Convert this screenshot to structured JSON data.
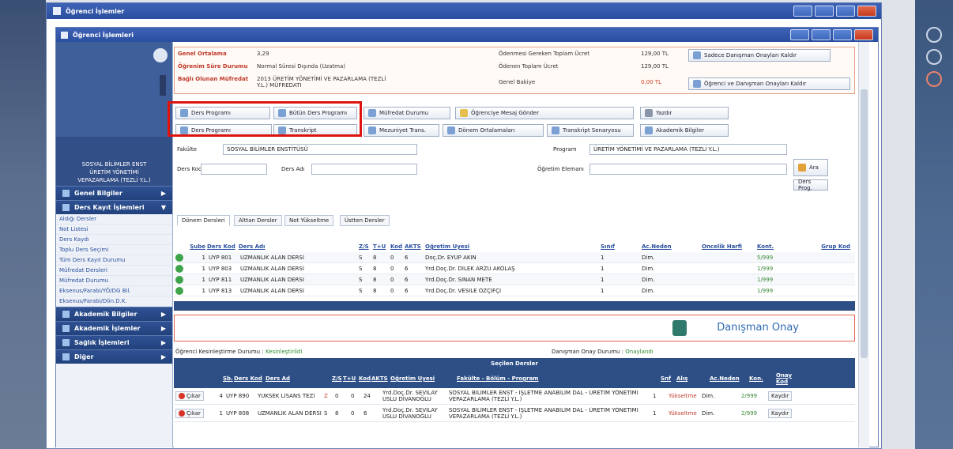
{
  "outer_window": {
    "title": "Öğrenci İşlemler"
  },
  "inner_window": {
    "title": "Öğrenci İşlemleri"
  },
  "sidebar": {
    "department": [
      "SOSYAL BİLİMLER ENST",
      "ÜRETİM YÖNETİMİ",
      "VEPAZARLAMA (TEZLİ Y.L.)"
    ],
    "sections": [
      {
        "label": "Genel Bilgiler"
      },
      {
        "label": "Ders Kayıt İşlemleri"
      }
    ],
    "links": [
      "Aldığı Dersler",
      "Not Listesi",
      "Ders Kaydı",
      "Toplu Ders Seçimi",
      "Tüm Ders Kayıt Durumu",
      "Müfredat Dersleri",
      "Müfredat Durumu",
      "Eksenus/Farabi/YÖ/DG Bil.",
      "Eksenus/Farabi/Dön.D.K."
    ],
    "bottom_sections": [
      {
        "label": "Akademik Bilgiler"
      },
      {
        "label": "Akademik İşlemler"
      },
      {
        "label": "Sağlık İşlemleri"
      },
      {
        "label": "Diğer"
      }
    ]
  },
  "info": {
    "gpa_label": "Genel Ortalama",
    "gpa_value": "3,29",
    "status_label": "Öğrenim Süre Durumu",
    "status_value": "Normal Süresi Dışında (Uzatma)",
    "curriculum_label": "Bağlı Olunan Müfredat",
    "curriculum_value": "2013 ÜRETİM YÖNETİMİ VE PAZARLAMA (TEZLİ Y.L.) MÜFREDATI",
    "fee_label": "Ödenmesi Gereken Toplam Ücret",
    "fee_value": "129,00 TL",
    "paid_label": "Ödenen Toplam Ücret",
    "paid_value": "129,00 TL",
    "balance_label": "Genel Bakiye",
    "balance_value": "0,00 TL",
    "btn_only_approved": "Sadece Danışman Onayları Kaldır",
    "btn_student_advisor": "Öğrenci ve Danışman Onayları Kaldır"
  },
  "toolbar": {
    "ders_programi": "Ders Programı",
    "butun_ders_programi": "Bütün Ders Programı",
    "mufredat_durumu": "Müfredat Durumu",
    "mesaj_gonder": "Öğrenciye Mesaj Gönder",
    "yazdir": "Yazdır",
    "ders_programi_2": "Ders Programı",
    "transkript": "Transkript",
    "mezuniyet": "Mezuniyet Trans.",
    "donem_ortalamalari": "Dönem Ortalamaları",
    "transkript_senaryosu": "Transkript Senaryosu",
    "akademik_bilgiler": "Akademik Bilgiler"
  },
  "filters": {
    "fakulte_label": "Fakülte",
    "fakulte_value": "SOSYAL BİLİMLER ENSTİTÜSÜ",
    "program_label": "Program",
    "program_value": "ÜRETİM YÖNETİMİ VE PAZARLAMA (TEZLİ Y.L.)",
    "ders_kodu_label": "Ders Kodu",
    "ders_adi_label": "Ders Adı",
    "ogretim_label": "Öğretim Elemanı",
    "ara_label": "Ara",
    "ders_prog_label": "Ders Prog."
  },
  "tabs": [
    "Dönem Dersleri",
    "Alttan Dersler",
    "Not Yükseltme",
    "Üstten Dersler"
  ],
  "course_grid": {
    "headers": [
      "Şube",
      "Ders Kod",
      "Ders Adı",
      "Z/S",
      "T+U",
      "Kod",
      "AKTS",
      "Öğretim Üyesi",
      "Sınıf",
      "Ac.Neden",
      "Öncelik Harfi",
      "Kont.",
      "Grup Kod"
    ],
    "rows": [
      [
        "1",
        "UYP 801",
        "UZMANLIK ALAN DERSİ",
        "S",
        "8",
        "0",
        "6",
        "Doç.Dr. EYÜP AKIN",
        "1",
        "Dim.",
        "",
        "5/999",
        ""
      ],
      [
        "1",
        "UYP 803",
        "UZMANLIK ALAN DERSİ",
        "S",
        "8",
        "0",
        "6",
        "Yrd.Doç.Dr. DİLEK ARZU AKOLAŞ",
        "1",
        "Dim.",
        "",
        "1/999",
        ""
      ],
      [
        "1",
        "UYP 811",
        "UZMANLIK ALAN DERSİ",
        "S",
        "8",
        "0",
        "6",
        "Yrd.Doç.Dr. SİNAN METE",
        "1",
        "Dim.",
        "",
        "1/999",
        ""
      ],
      [
        "1",
        "UYP 813",
        "UZMANLIK ALAN DERSİ",
        "S",
        "8",
        "0",
        "6",
        "Yrd.Doç.Dr. VESİLE ÖZÇİFÇİ",
        "1",
        "Dim.",
        "",
        "1/999",
        ""
      ]
    ]
  },
  "approval": {
    "label": "Danışman Onay"
  },
  "status_line": {
    "left_label": "Öğrenci Kesinleştirme Durumu :",
    "left_value": "Kesinleştirildi",
    "right_label": "Danışman Onay Durumu :",
    "right_value": "Onaylandı"
  },
  "selected": {
    "title": "Seçilen Dersler",
    "headers": [
      "Şb.",
      "Ders Kod",
      "Ders Ad",
      "Z/S",
      "T+U",
      "Kod",
      "AKTS",
      "Öğretim Üyesi",
      "Fakülte - Bölüm - Program",
      "Snf",
      "Alış",
      "Ac.Neden",
      "Kon.",
      "Önay Kod"
    ],
    "remove_label": "Çıkar",
    "shift_label": "Kaydır",
    "rows": [
      [
        "4",
        "UYP 890",
        "YÜKSEK LİSANS TEZİ",
        "Z",
        "0",
        "0",
        "24",
        "Yrd.Doç.Dr. SEVİLAY USLU DİVANOĞLU",
        "SOSYAL BİLİMLER ENST - İŞLETME ANABİLİM DAL - ÜRETİM YÖNETİMİ VEPAZARLAMA (TEZLİ Y.L.)",
        "1",
        "Yükseltme",
        "Dim.",
        "2/999"
      ],
      [
        "1",
        "UYP 808",
        "UZMANLIK ALAN DERSİ",
        "S",
        "8",
        "0",
        "6",
        "Yrd.Doç.Dr. SEVİLAY USLU DİVANOĞLU",
        "SOSYAL BİLİMLER ENST - İŞLETME ANABİLİM DAL - ÜRETİM YÖNETİMİ VEPAZARLAMA (TEZLİ Y.L.)",
        "1",
        "Yükseltme",
        "Dim.",
        "2/999"
      ]
    ]
  },
  "colors": {
    "title_bar": "#2b4f9f",
    "accent_red": "#e0140e",
    "grid_bar": "#2d4f86"
  }
}
